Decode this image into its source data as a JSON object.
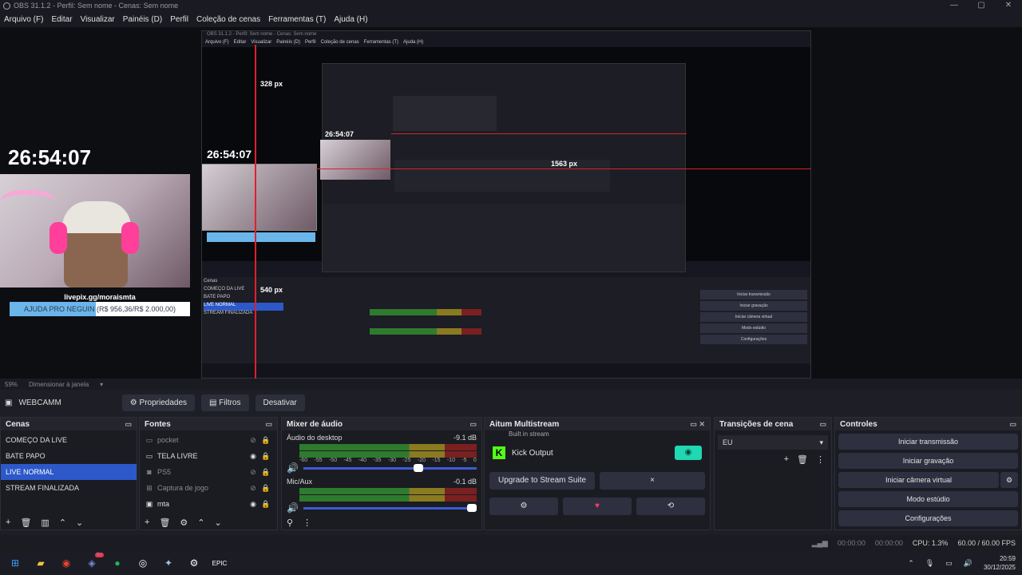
{
  "window": {
    "title": "OBS 31.1.2 - Perfil: Sem nome - Cenas: Sem nome"
  },
  "menu": [
    "Arquivo (F)",
    "Editar",
    "Visualizar",
    "Painéis (D)",
    "Perfil",
    "Coleção de cenas",
    "Ferramentas (T)",
    "Ajuda (H)"
  ],
  "preview": {
    "timer": "26:54:07",
    "livepix_handle": "livepix.gg/moraismta",
    "goal_text": "AJUDA PRO NEGUIN (R$ 956,36/R$ 2.000,00)",
    "goal_progress": 0.478,
    "nested_timer": "26:54:07",
    "measure_top": "328 px",
    "measure_left": "540 px",
    "measure_right": "1563 px"
  },
  "status_strip": {
    "zoom": "59%",
    "scale_mode": "Dimensionar à janela"
  },
  "source_bar": {
    "source": "WEBCAMM",
    "props": "Propriedades",
    "filters": "Filtros",
    "disable": "Desativar"
  },
  "scenes": {
    "title": "Cenas",
    "items": [
      "COMEÇO DA LIVE",
      "BATE PAPO",
      "LIVE NORMAL",
      "STREAM FINALIZADA"
    ],
    "selected": 2
  },
  "sources": {
    "title": "Fontes",
    "items": [
      {
        "name": "pocket",
        "icon": "monitor-icon",
        "dim": true
      },
      {
        "name": "TELA LIVRE",
        "icon": "monitor-icon",
        "dim": false
      },
      {
        "name": "PS5",
        "icon": "camera-icon",
        "dim": true
      },
      {
        "name": "Captura de jogo",
        "icon": "gamepad-icon",
        "dim": true
      },
      {
        "name": "mta",
        "icon": "window-icon",
        "dim": false
      }
    ]
  },
  "mixer": {
    "title": "Mixer de áudio",
    "channels": [
      {
        "name": "Áudio do desktop",
        "db": "-9.1 dB",
        "volume": 0.69
      },
      {
        "name": "Mic/Aux",
        "db": "-0.1 dB",
        "volume": 1.0
      }
    ],
    "ticks": [
      "-60",
      "-55",
      "-50",
      "-45",
      "-40",
      "-35",
      "-30",
      "-25",
      "-20",
      "-15",
      "-10",
      "-5",
      "0"
    ]
  },
  "multistream": {
    "title": "Aitum Multistream",
    "partial": "Built in stream",
    "output": "Kick Output",
    "upgrade": "Upgrade to Stream Suite",
    "close": "×"
  },
  "transitions": {
    "title": "Transições de cena",
    "selected": "EU"
  },
  "controls": {
    "title": "Controles",
    "buttons": [
      "Iniciar transmissão",
      "Iniciar gravação",
      "Iniciar câmera virtual",
      "Modo estúdio",
      "Configurações"
    ]
  },
  "statusbar": {
    "stream_time": "00:00:00",
    "rec_time": "00:00:00",
    "cpu": "CPU: 1.3%",
    "fps": "60.00 / 60.00 FPS"
  },
  "taskbar": {
    "time": "20:59",
    "date": "30/12/2025",
    "badge": "9+"
  },
  "colors": {
    "accent": "#2c58c9",
    "kick": "#53fc18",
    "toggle": "#1fd8b4",
    "measure": "#e0202a"
  }
}
